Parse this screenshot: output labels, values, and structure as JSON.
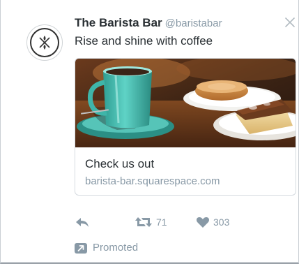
{
  "tweet": {
    "display_name": "The Barista Bar",
    "handle": "@baristabar",
    "text": "Rise and shine with coffee"
  },
  "icons": {
    "avatar": "barista-bar-logo",
    "close": "close-icon",
    "reply": "reply-icon",
    "retweet": "retweet-icon",
    "like": "heart-icon",
    "promoted": "promoted-arrow-icon"
  },
  "card": {
    "title": "Check us out",
    "url": "barista-bar.squarespace.com",
    "image": "coffee-cup-and-pastries-photo"
  },
  "actions": {
    "retweet_count": "71",
    "like_count": "303"
  },
  "promoted": {
    "label": "Promoted"
  },
  "colors": {
    "text": "#292f33",
    "muted": "#8899a6",
    "cup": "#47c1b4",
    "border": "#d6dbe0"
  }
}
